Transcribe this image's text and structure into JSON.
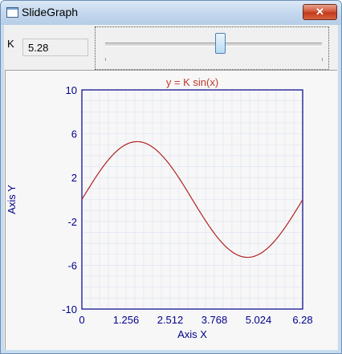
{
  "window": {
    "title": "SlideGraph",
    "close_glyph": "✕",
    "app_icon": "window-icon"
  },
  "controls": {
    "k_label": "K",
    "k_value": "5.28",
    "slider": {
      "min": 0,
      "max": 10,
      "value": 5.28,
      "ticks": [
        0,
        10
      ]
    }
  },
  "chart_data": {
    "type": "line",
    "title": "y = K sin(x)",
    "xlabel": "Axis X",
    "ylabel": "Axis Y",
    "xlim": [
      0,
      6.28
    ],
    "ylim": [
      -10,
      10
    ],
    "x_ticks": [
      "0",
      "1.256",
      "2.512",
      "3.768",
      "5.024",
      "6.28"
    ],
    "y_ticks": [
      "10",
      "6",
      "2",
      "-2",
      "-6",
      "-10"
    ],
    "grid": true,
    "series": [
      {
        "K": 5.28,
        "function": "K*sin(x)",
        "color": "#b22222"
      }
    ],
    "colors": {
      "axes": "#00008b",
      "grid": "#dde2f2",
      "title": "#c0392b"
    }
  }
}
